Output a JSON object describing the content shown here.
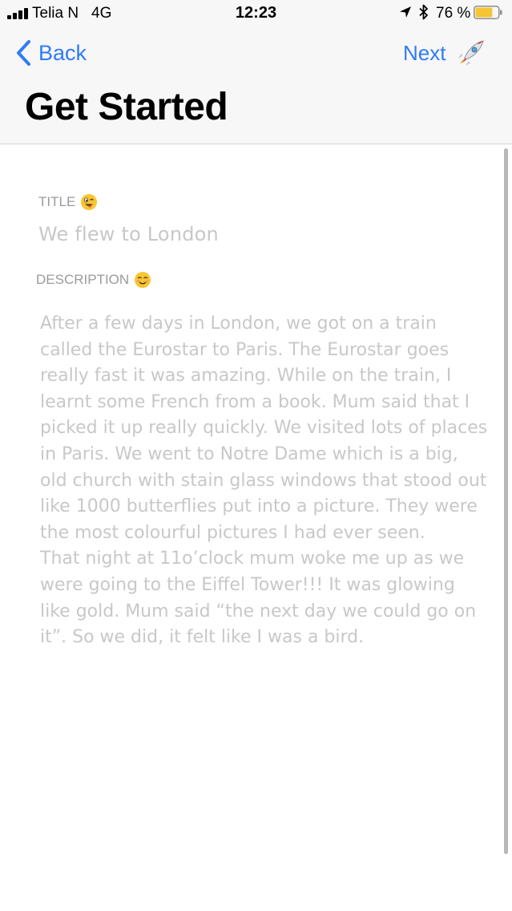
{
  "status_bar": {
    "carrier": "Telia N",
    "network": "4G",
    "time": "12:23",
    "battery_percent": "76 %",
    "battery_level": 0.76,
    "icons": [
      "signal-icon",
      "location-icon",
      "bluetooth-icon",
      "battery-icon"
    ]
  },
  "nav": {
    "back_label": "Back",
    "next_label": "Next",
    "next_icon": "rocket-icon",
    "title": "Get Started"
  },
  "form": {
    "title_label": "TITLE",
    "title_emoji": "winking-tongue-emoji",
    "title_value": "We flew to London",
    "description_label": "DESCRIPTION",
    "description_emoji": "smiling-face-emoji",
    "description_value": "After a few days in London, we got on a train called the Eurostar to Paris. The Eurostar goes really fast it was amazing. While on the train, I learnt some French from a book. Mum said that I picked it up really quickly. We visited lots of places in Paris. We went to Notre Dame which is a big, old church with stain glass windows that stood out like 1000 butterflies put into a picture. They were the most colourful pictures I had ever seen.\nThat night at 11o’clock mum woke me up as we were going to the Eiffel Tower!!! It was glowing like gold. Mum said “the next day we could go on it”. So we did, it felt like I was a bird."
  },
  "colors": {
    "accent": "#2f7cf6",
    "header_bg": "#f7f7f7",
    "label": "#9b9b9b",
    "field_text": "#c8c8c8",
    "battery_fill": "#f6c533"
  }
}
